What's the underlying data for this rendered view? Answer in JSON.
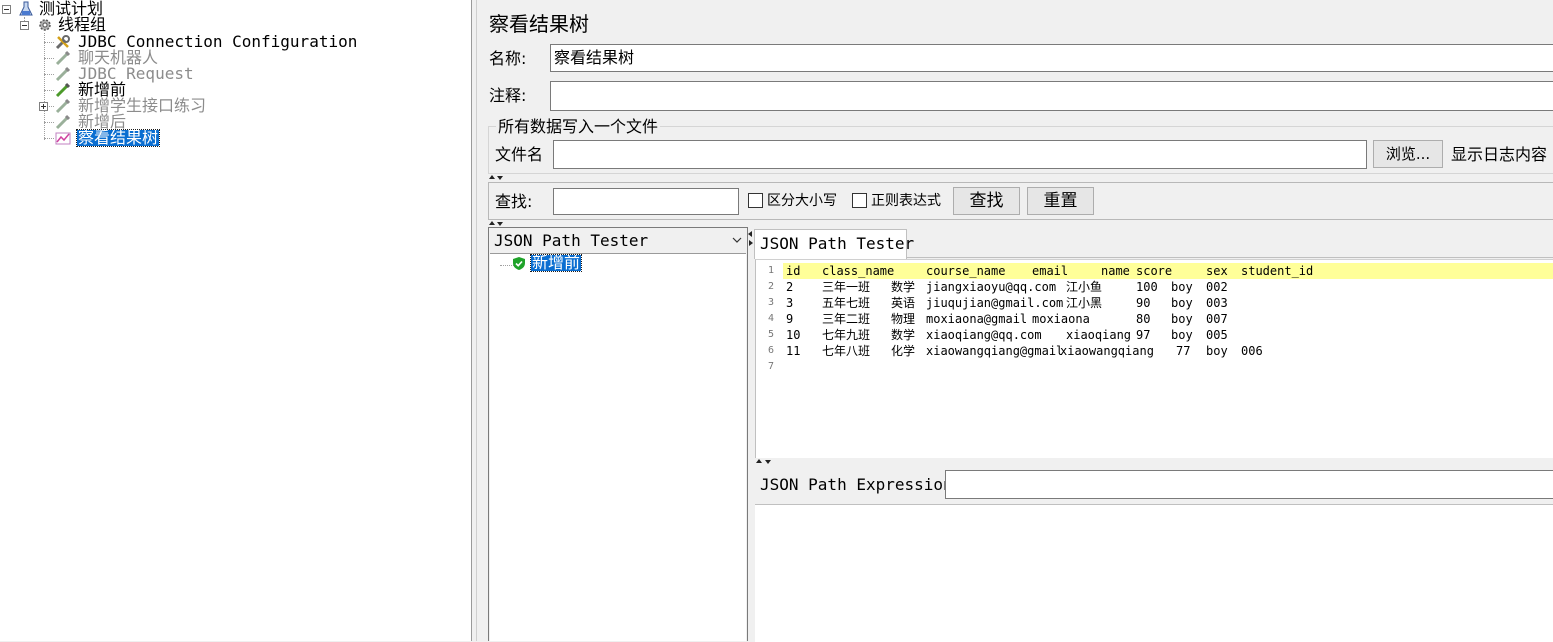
{
  "tree": {
    "nodes": [
      {
        "label": "测试计划"
      },
      {
        "label": "线程组"
      },
      {
        "label": "JDBC Connection Configuration"
      },
      {
        "label": "聊天机器人"
      },
      {
        "label": "JDBC Request"
      },
      {
        "label": "新增前"
      },
      {
        "label": "新增学生接口练习"
      },
      {
        "label": "新增后"
      },
      {
        "label": "察看结果树"
      }
    ]
  },
  "panel": {
    "title": "察看结果树",
    "name_label": "名称:",
    "name_value": "察看结果树",
    "comment_label": "注释:",
    "comment_value": "",
    "file_group_title": "所有数据写入一个文件",
    "file_label": "文件名",
    "file_value": "",
    "browse_button": "浏览...",
    "log_content_label": "显示日志内容"
  },
  "search": {
    "label": "查找:",
    "value": "",
    "case_sensitive": "区分大小写",
    "regex": "正则表达式",
    "find_button": "查找",
    "reset_button": "重置"
  },
  "results": {
    "renderer_selected": "JSON Path Tester",
    "sample_label": "新增前",
    "tab_label": "JSON Path Tester",
    "expression_label": "JSON Path Expression",
    "expression_value": ""
  },
  "response_table": {
    "line_numbers": [
      "1",
      "2",
      "3",
      "4",
      "5",
      "6",
      "7"
    ],
    "columns": [
      "id",
      "class_name",
      "course_name",
      "email",
      "name",
      "score",
      "sex",
      "student_id"
    ],
    "rows": [
      [
        "2",
        "三年一班",
        "数学",
        "jiangxiaoyu@qq.com",
        "江小鱼",
        "100",
        "boy",
        "002"
      ],
      [
        "3",
        "五年七班",
        "英语",
        "jiuqujian@gmail.com",
        "江小黑",
        "90",
        "boy",
        "003"
      ],
      [
        "9",
        "三年二班",
        "物理",
        "moxiaona@gmail",
        "moxiaona",
        "80",
        "boy",
        "007"
      ],
      [
        "10",
        "七年九班",
        "数学",
        "xiaoqiang@qq.com",
        "xiaoqiang",
        "97",
        "boy",
        "005"
      ],
      [
        "11",
        "七年八班",
        "化学",
        "xiaowangqiang@gmail",
        "xiaowangqiang",
        "77",
        "boy",
        "006"
      ]
    ]
  },
  "colors": {
    "selection": "#0a6ed1",
    "header_highlight": "#ffff99",
    "disabled_text": "#8c8c8c"
  }
}
